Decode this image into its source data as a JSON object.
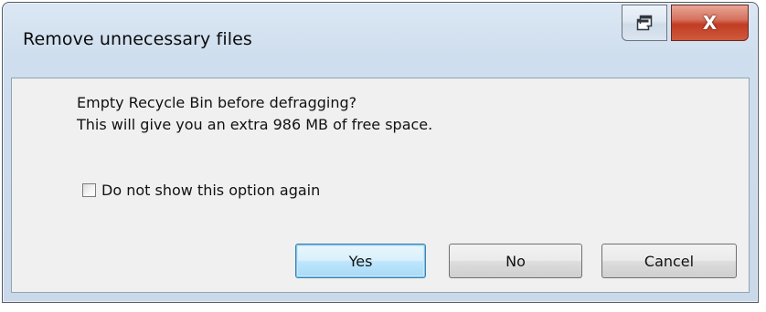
{
  "window": {
    "title": "Remove unnecessary files"
  },
  "caption_buttons": {
    "restore_icon": "restore-icon",
    "close_label": "X",
    "close_color": "#c13c23"
  },
  "dialog": {
    "message_line1": "Empty Recycle Bin before defragging?",
    "message_line2": "This will give you an extra 986 MB of free space.",
    "checkbox_label": "Do not show this option again",
    "checkbox_checked": false
  },
  "buttons": {
    "yes": "Yes",
    "no": "No",
    "cancel": "Cancel",
    "default_accent": "#3c7fb1"
  }
}
